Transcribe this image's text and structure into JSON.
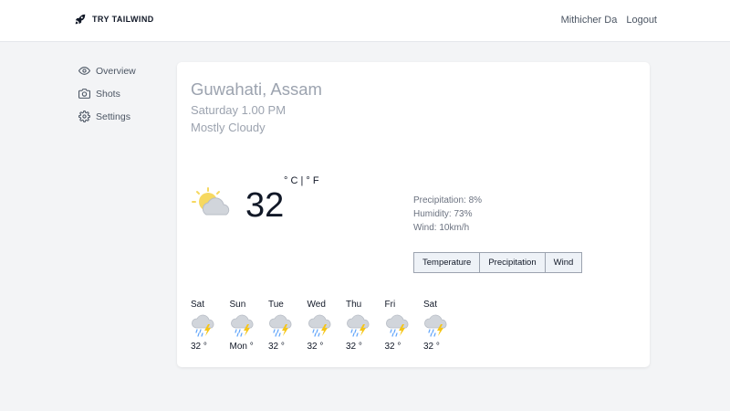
{
  "header": {
    "brand": "TRY TAILWIND",
    "user": "Mithicher Da",
    "logout": "Logout"
  },
  "sidebar": {
    "items": [
      {
        "label": "Overview",
        "icon": "eye-icon"
      },
      {
        "label": "Shots",
        "icon": "camera-icon"
      },
      {
        "label": "Settings",
        "icon": "gear-icon"
      }
    ]
  },
  "weather": {
    "city": "Guwahati, Assam",
    "datetime": "Saturday 1.00 PM",
    "condition": "Mostly Cloudy",
    "temperature": "32",
    "unit_toggle": "° C | ° F",
    "precipitation": "Precipitation: 8%",
    "humidity": "Humidity: 73%",
    "wind": "Wind: 10km/h",
    "icon": "partly-cloudy-icon"
  },
  "tabs": [
    "Temperature",
    "Precipitation",
    "Wind"
  ],
  "forecast": [
    {
      "day": "Sat",
      "temp": "32 °",
      "icon": "thunderstorm-icon"
    },
    {
      "day": "Sun",
      "temp": "Mon °",
      "icon": "thunderstorm-icon"
    },
    {
      "day": "Tue",
      "temp": "32 °",
      "icon": "thunderstorm-icon"
    },
    {
      "day": "Wed",
      "temp": "32 °",
      "icon": "thunderstorm-icon"
    },
    {
      "day": "Thu",
      "temp": "32 °",
      "icon": "thunderstorm-icon"
    },
    {
      "day": "Fri",
      "temp": "32 °",
      "icon": "thunderstorm-icon"
    },
    {
      "day": "Sat",
      "temp": "32 °",
      "icon": "thunderstorm-icon"
    }
  ],
  "colors": {
    "background": "#f3f4f6",
    "card": "#ffffff",
    "muted_text": "#9ca3af",
    "sun": "#f6d860",
    "cloud": "#d1d5db",
    "bolt": "#f5c518",
    "rain": "#60a5fa"
  }
}
